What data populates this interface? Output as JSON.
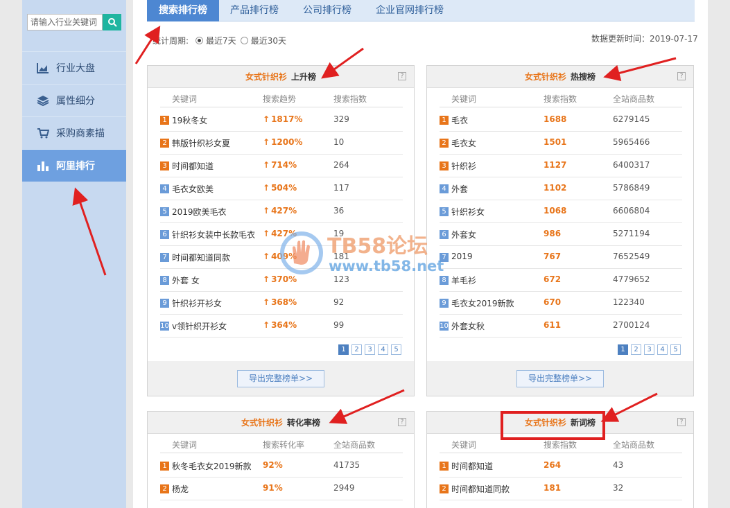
{
  "search": {
    "placeholder": "请输入行业关键词"
  },
  "sidebar": {
    "items": [
      {
        "label": "行业大盘",
        "icon": "area-chart-icon"
      },
      {
        "label": "属性细分",
        "icon": "layers-icon"
      },
      {
        "label": "采购商素描",
        "icon": "cart-icon"
      },
      {
        "label": "阿里排行",
        "icon": "bar-chart-icon"
      }
    ]
  },
  "tabs": [
    "搜索排行榜",
    "产品排行榜",
    "公司排行榜",
    "企业官网排行榜"
  ],
  "period": {
    "label": "统计周期:",
    "opt1": "最近7天",
    "opt2": "最近30天"
  },
  "update": "数据更新时间：2019-07-17",
  "watermark": {
    "t1": "TB58论坛",
    "t2": "www.tb58.net"
  },
  "panels": {
    "rise": {
      "category": "女式针织衫",
      "name": "上升榜",
      "cols": [
        "关键词",
        "搜索趋势",
        "搜索指数"
      ],
      "rows": [
        [
          "19秋冬女",
          "1817%",
          "329"
        ],
        [
          "韩版针织衫女夏",
          "1200%",
          "10"
        ],
        [
          "时间都知道",
          "714%",
          "264"
        ],
        [
          "毛衣女欧美",
          "504%",
          "117"
        ],
        [
          "2019欧美毛衣",
          "427%",
          "36"
        ],
        [
          "针织衫女装中长款毛衣",
          "427%",
          "19"
        ],
        [
          "时间都知道同款",
          "409%",
          "181"
        ],
        [
          "外套 女",
          "370%",
          "123"
        ],
        [
          "针织衫开衫女",
          "368%",
          "92"
        ],
        [
          "v领针织开衫女",
          "364%",
          "99"
        ]
      ],
      "pages": [
        "1",
        "2",
        "3",
        "4",
        "5"
      ],
      "export": "导出完整榜单>>"
    },
    "hot": {
      "category": "女式针织衫",
      "name": "热搜榜",
      "cols": [
        "关键词",
        "搜索指数",
        "全站商品数"
      ],
      "rows": [
        [
          "毛衣",
          "1688",
          "6279145"
        ],
        [
          "毛衣女",
          "1501",
          "5965466"
        ],
        [
          "针织衫",
          "1127",
          "6400317"
        ],
        [
          "外套",
          "1102",
          "5786849"
        ],
        [
          "针织衫女",
          "1068",
          "6606804"
        ],
        [
          "外套女",
          "986",
          "5271194"
        ],
        [
          "2019",
          "767",
          "7652549"
        ],
        [
          "羊毛衫",
          "672",
          "4779652"
        ],
        [
          "毛衣女2019新款",
          "670",
          "122340"
        ],
        [
          "外套女秋",
          "611",
          "2700124"
        ]
      ],
      "pages": [
        "1",
        "2",
        "3",
        "4",
        "5"
      ],
      "export": "导出完整榜单>>"
    },
    "conv": {
      "category": "女式针织衫",
      "name": "转化率榜",
      "cols": [
        "关键词",
        "搜索转化率",
        "全站商品数"
      ],
      "rows": [
        [
          "秋冬毛衣女2019新款",
          "92%",
          "41735"
        ],
        [
          "杨龙",
          "91%",
          "2949"
        ]
      ]
    },
    "new": {
      "category": "女式针织衫",
      "name": "新词榜",
      "cols": [
        "关键词",
        "搜索指数",
        "全站商品数"
      ],
      "rows": [
        [
          "时间都知道",
          "264",
          "43"
        ],
        [
          "时间都知道同款",
          "181",
          "32"
        ]
      ]
    }
  },
  "colors": {
    "rank_top": "#e8751a",
    "rank_rest": "#6a9bd8",
    "accent": "#4d87d2",
    "highlight": "#e02020"
  }
}
